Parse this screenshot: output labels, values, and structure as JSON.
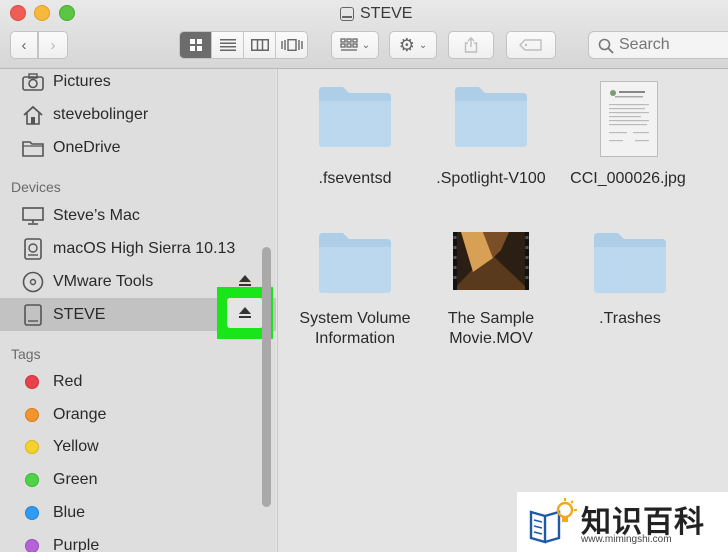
{
  "window": {
    "title": "STEVE"
  },
  "toolbar": {
    "search_placeholder": "Search",
    "views": [
      "icon-view",
      "list-view",
      "column-view",
      "cover-flow-view"
    ],
    "active_view": "icon-view"
  },
  "sidebar": {
    "favorites": [
      {
        "label": "Pictures",
        "icon": "camera-icon"
      },
      {
        "label": "stevebolinger",
        "icon": "home-icon"
      },
      {
        "label": "OneDrive",
        "icon": "folder-icon"
      }
    ],
    "devices_header": "Devices",
    "devices": [
      {
        "label": "Steve’s Mac",
        "icon": "computer-icon"
      },
      {
        "label": "macOS High Sierra 10.13",
        "icon": "disk-icon"
      },
      {
        "label": "VMware Tools",
        "icon": "cd-icon"
      },
      {
        "label": "STEVE",
        "icon": "external-drive-icon",
        "selected": true
      }
    ],
    "tags_header": "Tags",
    "tags": [
      {
        "label": "Red",
        "color": "#e8414a"
      },
      {
        "label": "Orange",
        "color": "#f2952f"
      },
      {
        "label": "Yellow",
        "color": "#f6d22c"
      },
      {
        "label": "Green",
        "color": "#4fd346"
      },
      {
        "label": "Blue",
        "color": "#2f9bf3"
      },
      {
        "label": "Purple",
        "color": "#b663d8"
      }
    ]
  },
  "files": [
    {
      "name": ".fseventsd",
      "kind": "folder"
    },
    {
      "name": ".Spotlight-V100",
      "kind": "folder"
    },
    {
      "name": "CCI_000026.jpg",
      "kind": "image"
    },
    {
      "name_line1": "System Volume",
      "name_line2": "Information",
      "kind": "folder"
    },
    {
      "name_line1": "The Sample",
      "name_line2": "Movie.MOV",
      "kind": "movie"
    },
    {
      "name": ".Trashes",
      "kind": "folder"
    }
  ],
  "highlight_color": "#19e619",
  "watermark": {
    "text": "知识百科",
    "url": "www.mimingshi.com"
  }
}
